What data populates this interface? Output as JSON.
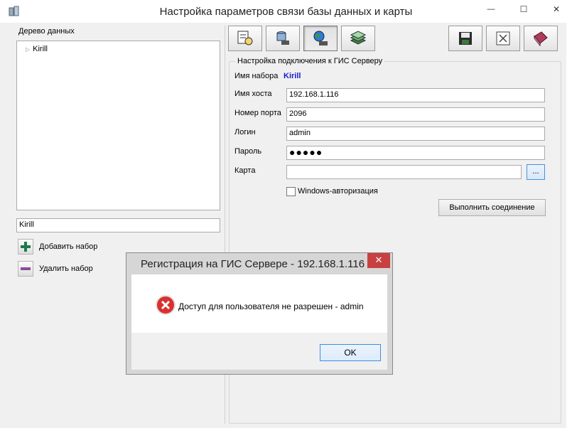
{
  "window": {
    "title": "Настройка параметров связи базы данных и карты",
    "controls": {
      "minimize": "—",
      "maximize": "☐",
      "close": "✕"
    }
  },
  "left": {
    "tree_label": "Дерево данных",
    "tree_items": [
      {
        "label": "Kirill",
        "expander": "▷"
      }
    ],
    "name_value": "Kirill",
    "add_label": "Добавить набор",
    "remove_label": "Удалить набор"
  },
  "toolbar": {
    "tools": [
      {
        "icon": "report-settings-icon"
      },
      {
        "icon": "database-icon"
      },
      {
        "icon": "globe-network-icon",
        "pressed": true
      },
      {
        "icon": "layers-icon"
      }
    ],
    "actions": [
      {
        "icon": "save-icon"
      },
      {
        "icon": "cancel-icon"
      },
      {
        "icon": "help-book-icon"
      }
    ]
  },
  "form": {
    "legend": "Настройка подключения к ГИС Серверу",
    "set_name_label": "Имя набора",
    "set_name_value": "Kirill",
    "host_label": "Имя хоста",
    "host_value": "192.168.1.116",
    "port_label": "Номер порта",
    "port_value": "2096",
    "login_label": "Логин",
    "login_value": "admin",
    "password_label": "Пароль",
    "password_value": "●●●●●",
    "map_label": "Карта",
    "map_value": "",
    "browse_label": "...",
    "windows_auth_label": "Windows-авторизация",
    "windows_auth_checked": false,
    "connect_label": "Выполнить соединение"
  },
  "dialog": {
    "title": "Регистрация на ГИС Сервере - 192.168.1.116",
    "close": "✕",
    "message": "Доступ для пользователя не разрешен - admin",
    "ok_label": "OK",
    "icon": "error-icon"
  },
  "colors": {
    "accent": "#1a1ad0",
    "error": "#d93030",
    "close": "#c94040"
  }
}
